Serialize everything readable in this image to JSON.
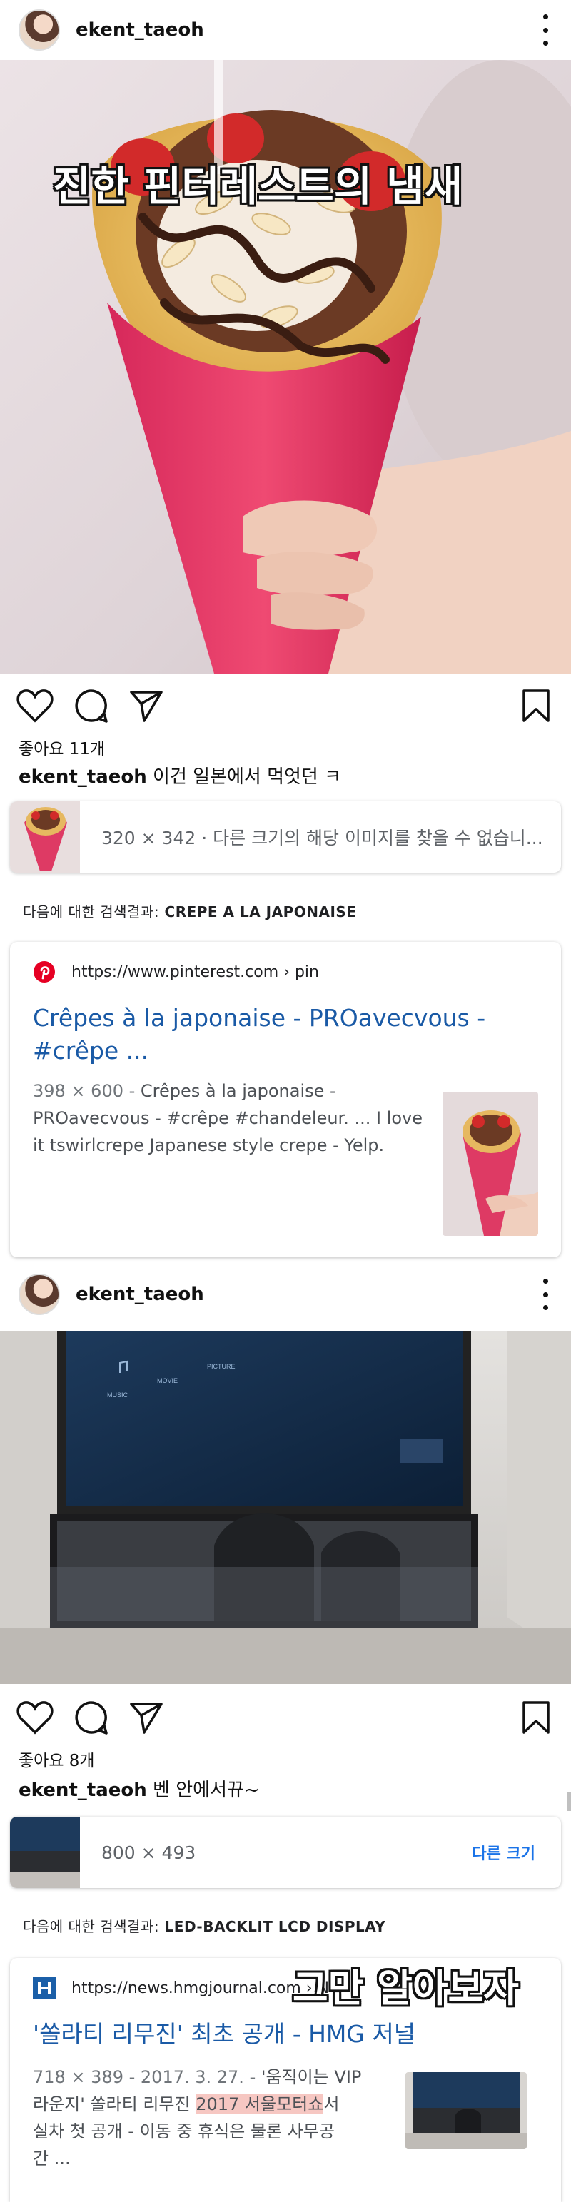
{
  "post1": {
    "username": "ekent_taeoh",
    "overlay_caption": "진한 핀터레스트의 냄새",
    "likes": "좋아요 11개",
    "caption_user": "ekent_taeoh",
    "caption_text": "이건 일본에서 먹엇던 ㅋ"
  },
  "lens1": {
    "info": "320 × 342 · 다른 크기의 해당 이미지를 찾을 수 없습니..."
  },
  "search1": {
    "prefix": "다음에 대한 검색결과:",
    "query": "CREPE A LA JAPONAISE"
  },
  "result1": {
    "url": "https://www.pinterest.com › pin",
    "title_line1": "Crêpes à la japonaise - PROavecvous -",
    "title_line2": "#crêpe ...",
    "meta": "398 × 600 -",
    "snippet_line1_rest": "Crêpes à la japonaise -",
    "snippet_line2": "PROavecvous - #crêpe #chandeleur. ... I love",
    "snippet_line3": "it tswirlcrepe Japanese style crepe - Yelp."
  },
  "post2": {
    "username": "ekent_taeoh",
    "screen_labels": [
      "MUSIC",
      "MOVIE",
      "PICTURE"
    ],
    "likes": "좋아요 8개",
    "caption_user": "ekent_taeoh",
    "caption_text": "벤 안에서뀨~"
  },
  "lens2": {
    "info": "800 × 493",
    "link": "다른 크기"
  },
  "search2": {
    "prefix": "다음에 대한 검색결과:",
    "query": "LED-BACKLIT LCD DISPLAY"
  },
  "result2": {
    "url": "https://news.hmgjournal.com › N",
    "overlay_caption": "그만 알아보자",
    "title": "'쏠라티 리무진' 최초 공개 - HMG 저널",
    "meta": "718 × 389 - 2017. 3. 27. -",
    "snippet_line1_rest": "'움직이는 VIP",
    "snippet_line2_a": "라운지' 쏠라티 리무진",
    "snippet_line2_hl": "2017 서울모터쇼",
    "snippet_line2_b": "서",
    "snippet_line3": "실차 첫 공개 - 이동 중 휴식은 물론 사무공",
    "snippet_line4": "간 ..."
  },
  "icons": {
    "heart": "heart-icon",
    "comment": "comment-icon",
    "share": "send-icon",
    "save": "bookmark-icon",
    "more": "more-icon",
    "pinterest": "pinterest-icon",
    "hmg": "hmg-icon"
  },
  "colors": {
    "link_blue": "#1a5aa6",
    "accent_blue": "#1a73e8",
    "pinterest_red": "#e60023",
    "hmg_blue": "#1b5fa8",
    "highlight": "#f6c7c2"
  }
}
